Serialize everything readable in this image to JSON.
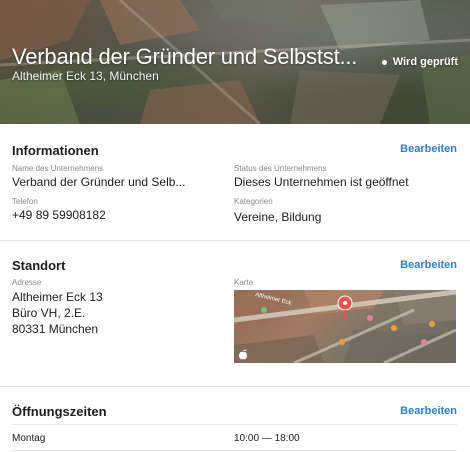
{
  "header": {
    "title": "Verband der Gründer und Selbstst...",
    "address": "Altheimer Eck 13, München",
    "status": "Wird geprüft"
  },
  "info": {
    "heading": "Informationen",
    "edit": "Bearbeiten",
    "name_label": "Name des Unternehmens",
    "name_value": "Verband der Gründer und Selb...",
    "status_label": "Status des Unternehmens",
    "status_value": "Dieses Unternehmen ist geöffnet",
    "phone_label": "Telefon",
    "phone_value": "+49 89 59908182",
    "category_label": "Kategorien",
    "category_value": "Vereine, Bildung"
  },
  "location": {
    "heading": "Standort",
    "edit": "Bearbeiten",
    "address_label": "Adresse",
    "address_lines": [
      "Altheimer Eck 13",
      "Büro VH, 2.E.",
      "80331 München"
    ],
    "map_label": "Karte",
    "map_street": "Altheimer Eck"
  },
  "hours": {
    "heading": "Öffnungszeiten",
    "edit": "Bearbeiten",
    "rows": [
      {
        "day": "Montag",
        "time": "10:00 — 18:00"
      }
    ]
  },
  "colors": {
    "accent": "#2c7fd6",
    "pin": "#e8534f"
  }
}
